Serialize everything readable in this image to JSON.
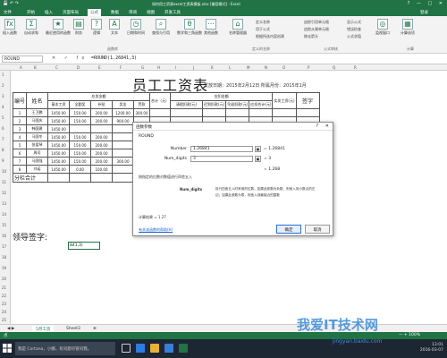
{
  "window": {
    "quick_access": "💾 ↶ ↷",
    "title": "如何用工资表excel工资表模板.xlsx [兼容模式] - Excel",
    "controls": "? — □ ✕"
  },
  "ribbon_tabs": [
    "文件",
    "开始",
    "插入",
    "页面布局",
    "公式",
    "数据",
    "审阅",
    "视图",
    "开发工具",
    "登录"
  ],
  "ribbon": {
    "insert_function": "插入函数",
    "autosum": "自动求和",
    "recent": "最近使用的函数",
    "finance": "财务",
    "logic": "逻辑",
    "text": "文本",
    "datetime": "日期和时间",
    "lookup": "查找与引用",
    "math": "数学和三角函数",
    "more": "其他函数",
    "library_group": "函数库",
    "name_mgr": "名称管理器",
    "define_name": "定义名称",
    "use_in_formula": "用于公式",
    "create_from_sel": "根据所选内容创建",
    "names_group": "定义的名称",
    "trace_prec": "追踪引用单元格",
    "trace_dep": "追踪从属单元格",
    "remove_arrows": "移去箭头",
    "show_formulas": "显示公式",
    "error_check": "错误检查",
    "eval_formula": "公式求值",
    "audit_group": "公式审核",
    "watch": "监视窗口",
    "calc_options": "计算选项",
    "calc_group": "计算"
  },
  "formula_bar": {
    "name_box": "ROUND",
    "fx": "✕ ✓ fx",
    "formula": "=ROUND(1.26841,3)"
  },
  "columns": [
    "A",
    "B",
    "C",
    "D",
    "E",
    "F",
    "G",
    "H",
    "I",
    "J",
    "K",
    "L",
    "M",
    "N",
    "O",
    "P",
    "Q",
    "R"
  ],
  "rows": [
    "1",
    "2",
    "3",
    "4",
    "5",
    "6",
    "7",
    "8",
    "9",
    "10",
    "11",
    "12",
    "13",
    "14",
    "15",
    "16",
    "17",
    "18",
    "19",
    "20",
    "21",
    "22",
    "23",
    "24",
    "25",
    "26",
    "27",
    "28",
    "29",
    "30"
  ],
  "sheet": {
    "title": "员工工资表",
    "subtitle": "发放日期：2015年2月12日 所属月份：2015年1月",
    "hdr_no": "编号",
    "hdr_name": "姓名",
    "hdr_payable": "应发金额",
    "hdr_deduct": "应扣金额",
    "hdr_base": "基本工资",
    "hdr_full": "全勤奖",
    "hdr_allow": "补贴",
    "hdr_bonus": "奖金",
    "hdr_fine": "罚款",
    "hdr_total": "合计（元）",
    "hdr_leave": "请假扣款(元)",
    "hdr_late": "迟到扣款(元)",
    "hdr_early": "早退扣款(元)",
    "hdr_ded_total": "应扣合计(元)",
    "hdr_actual": "实发工资(元)",
    "hdr_sign": "签字",
    "rows": [
      {
        "no": "1",
        "name": "王卫鹏",
        "base": "1450.00",
        "full": "150.00",
        "allow": "200.00",
        "bonus": "1200.00",
        "fine": "300.00"
      },
      {
        "no": "2",
        "name": "马国庆",
        "base": "1450.00",
        "full": "150.00",
        "allow": "200.00",
        "bonus": "900.00",
        "fine": ""
      },
      {
        "no": "3",
        "name": "韩国建",
        "base": "1450.00",
        "full": "",
        "allow": "",
        "bonus": "",
        "fine": ""
      },
      {
        "no": "4",
        "name": "马国冬",
        "base": "1450.00",
        "full": "150.00",
        "allow": "200.00",
        "bonus": "",
        "fine": ""
      },
      {
        "no": "5",
        "name": "张爱琴",
        "base": "1450.00",
        "full": "150.00",
        "allow": "200.00",
        "bonus": "",
        "fine": ""
      },
      {
        "no": "6",
        "name": "周司",
        "base": "1450.00",
        "full": "150.00",
        "allow": "200.00",
        "bonus": "",
        "fine": ""
      },
      {
        "no": "7",
        "name": "马国强",
        "base": "1450.00",
        "full": "150.00",
        "allow": "200.00",
        "bonus": "300.00",
        "fine": ""
      },
      {
        "no": "8",
        "name": "刘诺",
        "base": "1450.00",
        "full": "0.00",
        "allow": "100.00",
        "bonus": "",
        "fine": ""
      }
    ],
    "subtotal": "分栏合计",
    "leader_sign": "领导签字:",
    "active_cell": "841,3)"
  },
  "dialog": {
    "title": "函数参数",
    "help": "?",
    "close": "✕",
    "func_name": "ROUND",
    "arg1_label": "Number",
    "arg1_value": "1.26841",
    "arg1_result": "= 1.26841",
    "arg2_label": "Num_digits",
    "arg2_value": "3",
    "arg2_result": "= 3",
    "total_result": "= 1.268",
    "desc": "按指定的位数对数值进行四舍五入",
    "arg_desc_label": "Num_digits",
    "arg_desc_1": "执行四舍五入时采用的位数。如果此参数为负数，则舍入到小数点的左",
    "arg_desc_2": "边；如果此参数为零，则舍入到最接近的整数",
    "calc_label": "计算结果 = 1.27",
    "help_link": "有关该函数的帮助(H)",
    "ok": "确定",
    "cancel": "取消"
  },
  "sheet_tabs": [
    "5月工资",
    "Sheet3",
    "⊕"
  ],
  "status": {
    "mode": "点",
    "zoom": "— + 100%"
  },
  "taskbar": {
    "search_placeholder": "我是 Cortana，小娜。有问题尽管问我。",
    "time": "13:01",
    "date": "2016-03-07"
  },
  "watermark": {
    "text": "我爱IT技术网",
    "url": "jingyan.baidu.com"
  },
  "colors": {
    "excel_green": "#217346",
    "taskbar": "#1d2733",
    "accent_blue": "#2a6ed8"
  }
}
